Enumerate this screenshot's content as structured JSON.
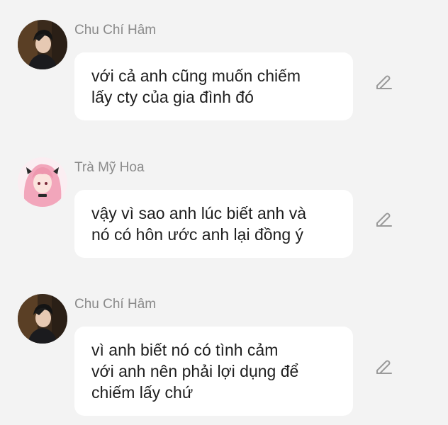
{
  "messages": [
    {
      "sender": "Chu Chí Hâm",
      "lines": [
        "với cả anh cũng muốn chiếm",
        "lấy cty của gia đình đó"
      ],
      "avatar_icon": "dark-haired-man-avatar"
    },
    {
      "sender": "Trà Mỹ Hoa",
      "lines": [
        "vậy vì sao anh lúc biết anh và",
        "nó có hôn ước anh lại đồng ý"
      ],
      "avatar_icon": "pink-haired-anime-girl-avatar"
    },
    {
      "sender": "Chu Chí Hâm",
      "lines": [
        "vì anh biết nó có tình cảm",
        "với anh nên phải lợi dụng để",
        "chiếm lấy chứ"
      ],
      "avatar_icon": "dark-haired-man-avatar"
    }
  ],
  "edit_icon": "pencil-edit-icon",
  "colors": {
    "background": "#f3f3f3",
    "bubble": "#ffffff",
    "sender_text": "#8a8a8a",
    "message_text": "#1e1e1e",
    "icon": "#9a9a9a"
  }
}
